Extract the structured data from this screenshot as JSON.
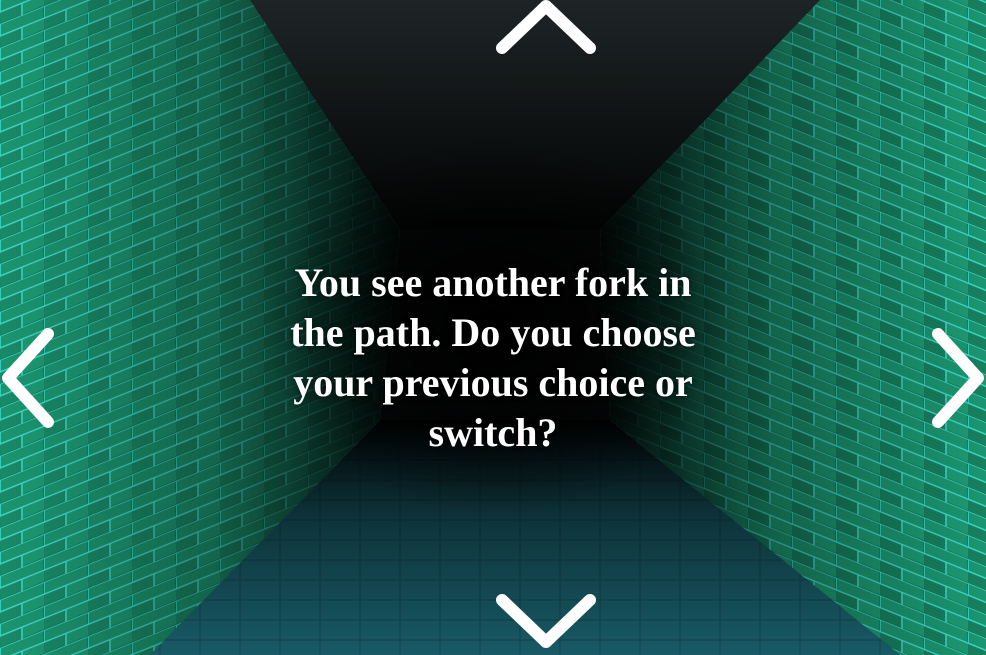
{
  "prompt": {
    "text": "You see another fork in the path. Do you choose your previous choice or switch?"
  },
  "navigation": {
    "up_icon": "chevron-up-icon",
    "down_icon": "chevron-down-icon",
    "left_icon": "chevron-left-icon",
    "right_icon": "chevron-right-icon"
  },
  "colors": {
    "wall_brick": "#1a8f6f",
    "wall_mortar": "#2fd3c0",
    "floor": "#124a54",
    "ceiling": "#0a0c0d",
    "text": "#ffffff",
    "arrow": "#ffffff"
  }
}
